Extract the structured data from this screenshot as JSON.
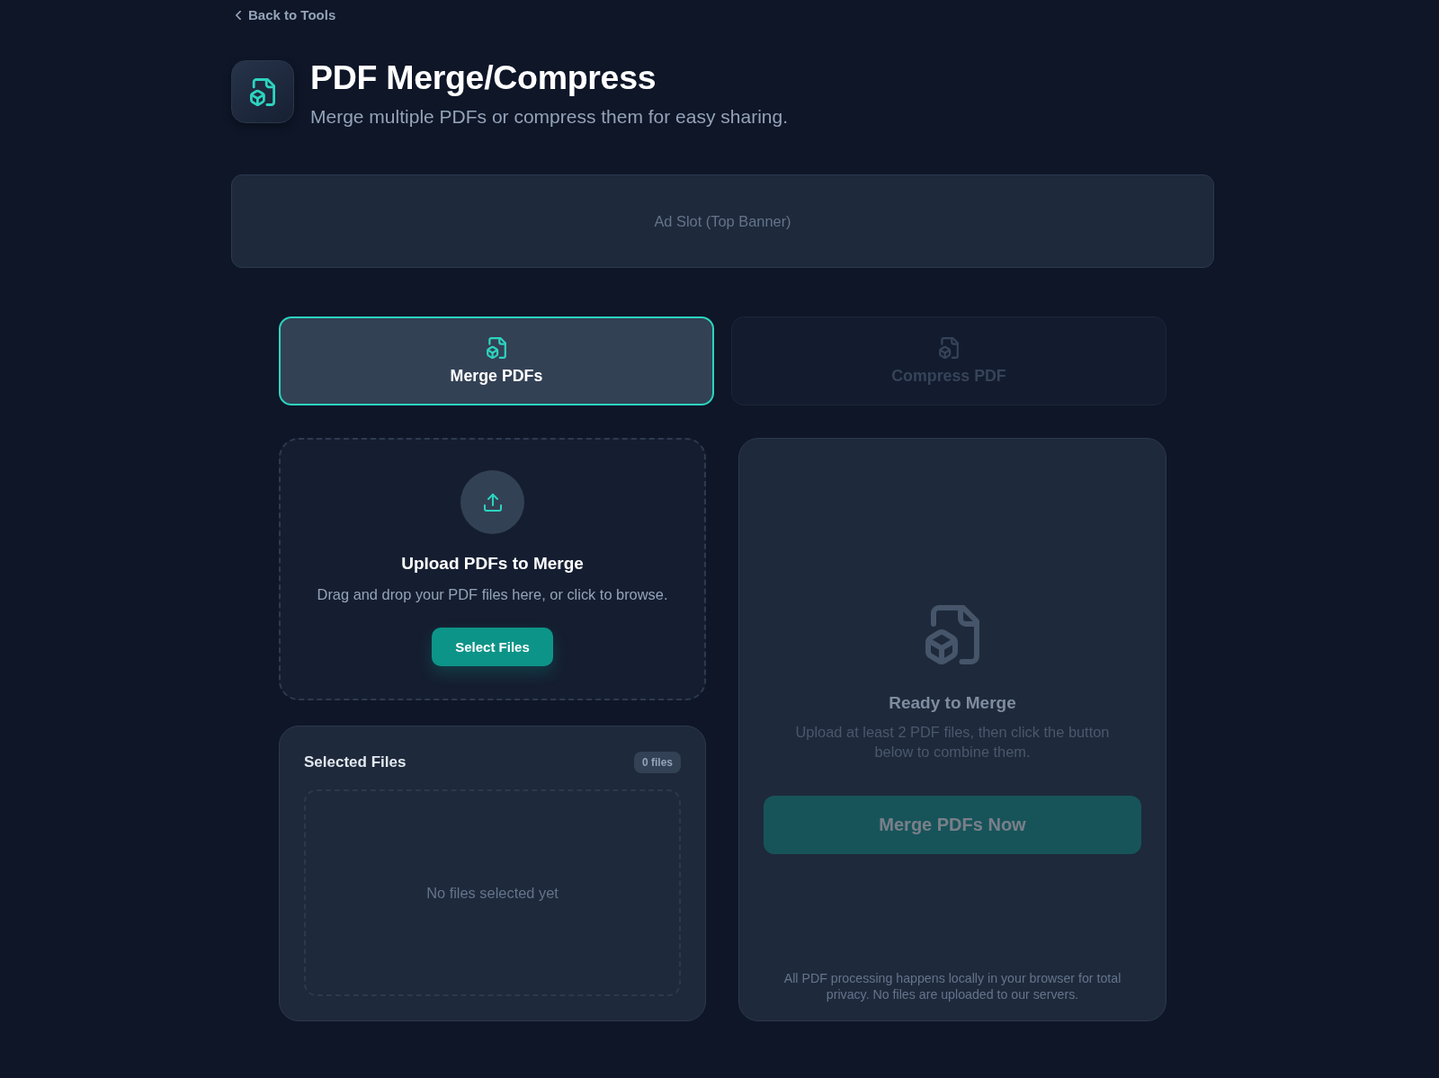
{
  "back_link": {
    "label": "Back to Tools"
  },
  "header": {
    "title": "PDF Merge/Compress",
    "subtitle": "Merge multiple PDFs or compress them for easy sharing."
  },
  "ad_slot": {
    "label": "Ad Slot (Top Banner)"
  },
  "tabs": [
    {
      "label": "Merge PDFs",
      "selected": true
    },
    {
      "label": "Compress PDF",
      "selected": false
    }
  ],
  "upload": {
    "title": "Upload PDFs to Merge",
    "description": "Drag and drop your PDF files here, or click to browse.",
    "button": "Select Files"
  },
  "selected_files": {
    "title": "Selected Files",
    "count": "0 files",
    "empty_text": "No files selected yet"
  },
  "merge_panel": {
    "title": "Ready to Merge",
    "description": "Upload at least 2 PDF files, then click the button below to combine them.",
    "button": {
      "label": "Merge PDFs Now",
      "disabled": true
    },
    "note": "All PDF processing happens locally in your browser for total privacy. No files are uploaded to our servers."
  }
}
